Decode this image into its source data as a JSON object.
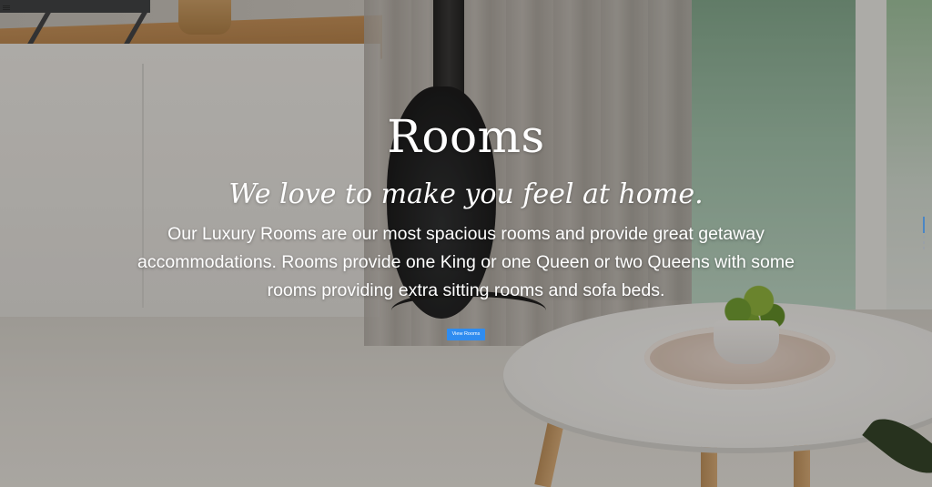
{
  "nav": {
    "menu_icon": "hamburger-menu-icon"
  },
  "hero": {
    "title": "Rooms",
    "subtitle": "We love to make you feel at home.",
    "description": "Our Luxury Rooms are our most spacious rooms and provide great getaway accommodations. Rooms provide one King or one Queen or two Queens with some rooms providing extra sitting rooms and sofa beds.",
    "cta_label": "View Rooms"
  },
  "colors": {
    "text": "#ffffff",
    "button": "#2f8cf0",
    "scroll_active": "#4a86c5"
  }
}
